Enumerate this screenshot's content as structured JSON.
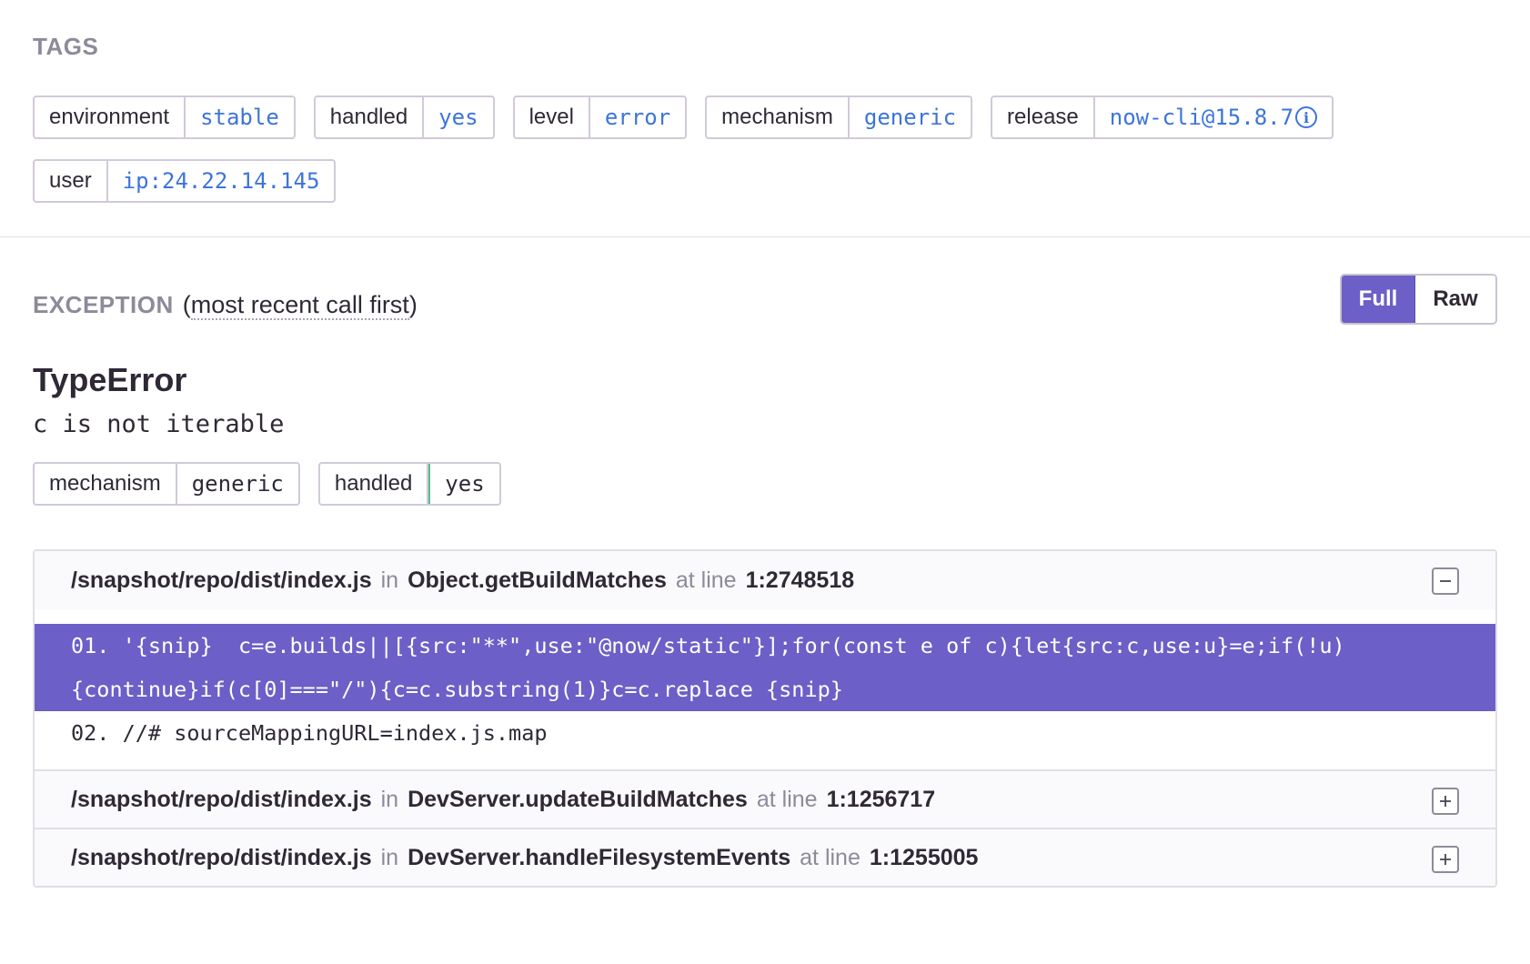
{
  "tags_section": {
    "title": "TAGS",
    "tags": [
      {
        "key": "environment",
        "value": "stable"
      },
      {
        "key": "handled",
        "value": "yes"
      },
      {
        "key": "level",
        "value": "error"
      },
      {
        "key": "mechanism",
        "value": "generic"
      },
      {
        "key": "release",
        "value": "now-cli@15.8.7",
        "icon": "info-icon"
      },
      {
        "key": "user",
        "value": "ip:24.22.14.145"
      }
    ]
  },
  "exception": {
    "title": "EXCEPTION",
    "subtitle_open": "(",
    "subtitle_text": "most recent call first",
    "subtitle_close": ")",
    "toggle": {
      "full": "Full",
      "raw": "Raw",
      "selected": "Full"
    },
    "type": "TypeError",
    "value": "c is not iterable",
    "mechanism_tags": [
      {
        "key": "mechanism",
        "value": "generic"
      },
      {
        "key": "handled",
        "value": "yes"
      }
    ],
    "frames": [
      {
        "file": "/snapshot/repo/dist/index.js",
        "in_label": "in",
        "function": "Object.getBuildMatches",
        "at_label": "at line",
        "line": "1:2748518",
        "expanded": true,
        "toggle_icon": "minus-icon",
        "code": [
          {
            "number": "01.",
            "text": "'{snip}  c=e.builds||[{src:\"**\",use:\"@now/static\"}];for(const e of c){let{src:c,use:u}=e;if(!u){continue}if(c[0]===\"/\"){c=c.substring(1)}c=c.replace {snip}",
            "active": true
          },
          {
            "number": "02.",
            "text": "//# sourceMappingURL=index.js.map",
            "active": false
          }
        ]
      },
      {
        "file": "/snapshot/repo/dist/index.js",
        "in_label": "in",
        "function": "DevServer.updateBuildMatches",
        "at_label": "at line",
        "line": "1:1256717",
        "expanded": false,
        "toggle_icon": "plus-icon"
      },
      {
        "file": "/snapshot/repo/dist/index.js",
        "in_label": "in",
        "function": "DevServer.handleFilesystemEvents",
        "at_label": "at line",
        "line": "1:1255005",
        "expanded": false,
        "toggle_icon": "plus-icon"
      }
    ]
  },
  "colors": {
    "accent": "#6c5fc7",
    "link": "#3d74db",
    "muted": "#8e8a9a",
    "handled_border": "#57be8c"
  }
}
